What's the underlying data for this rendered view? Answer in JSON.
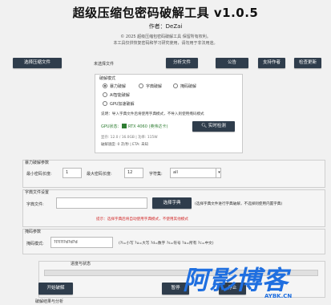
{
  "header": {
    "title": "超级压缩包密码破解工具 v1.0.5",
    "author": "作者：DeZai",
    "copyright_line1": "© 2025 超级压缩包密码破解工具 保留所有权利。",
    "copyright_line2": "本工具仅供恢复密码和学习研究使用，请勿用于非法用途。"
  },
  "toolbar": {
    "select_file": "选择压缩文件",
    "file_status": "未选择文件",
    "analyze": "分析文件",
    "announcement": "公告",
    "support": "支持作者",
    "update": "检查更新"
  },
  "crack_mode": {
    "title": "破解模式",
    "options": [
      "暴力破解",
      "字典破解",
      "掩码破解",
      "AI智能破解",
      "GPU加速破解"
    ],
    "selected": "暴力破解",
    "note": "说明：导入字典文件后将使用字典模式，不导入则使用掩码模式",
    "gpu_status": "GPU状态：",
    "gpu_name": "RTX 4060 (英伟达卡)",
    "realtime_btn": "实时检测",
    "stats_line": "显存: 12.0 / 16.0GB | 功率: 115W",
    "speed_line": "破解速度: 0 次/秒 | ETA: 未知"
  },
  "brute": {
    "title": "暴力破解参数",
    "min_len_label": "最小密码长度:",
    "min_len": "1",
    "max_len_label": "最大密码长度:",
    "max_len": "12",
    "charset_label": "字符集:",
    "charset": "all"
  },
  "dict": {
    "title": "字典文件设置",
    "file_label": "字典文件:",
    "file_value": "",
    "select_btn": "选择字典",
    "hint": "(选择字典文件进行字典破解，不选择则使用内置字典)",
    "warning": "提示：选择字典后将自动使用字典模式，不使用其他模式"
  },
  "mask": {
    "title": "掩码参数",
    "label": "掩码模式:",
    "value": "?l?l?l?d?d?d",
    "hint": "(?l=小写 ?u=大写 ?d=数字 ?s=符号 ?a=所有 ?c=中文)"
  },
  "progress": {
    "title": "进度与状态",
    "percent": 0,
    "start": "开始破解",
    "pause": "暂停",
    "stop": "停止",
    "bottom_label": "破解结果与分析"
  },
  "watermark": {
    "text": "阿影博客",
    "url": "AYBK.CN"
  },
  "colors": {
    "button_dark": "#2f3d4c",
    "accent_blue": "#1f6fe0",
    "green": "#2e7d32",
    "warning_red": "#d32f2f"
  }
}
